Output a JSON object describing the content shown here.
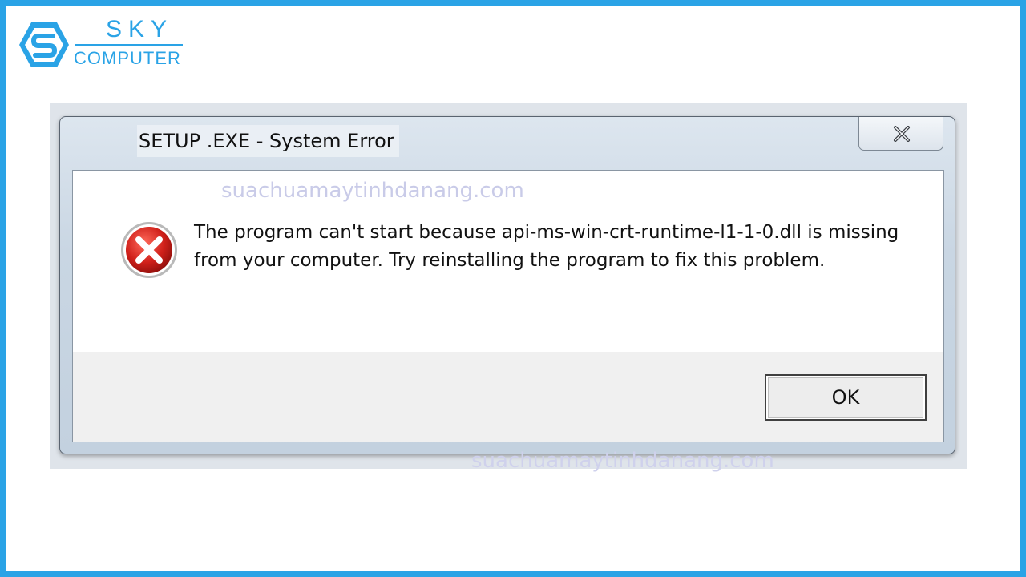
{
  "branding": {
    "logo_top": "SKY",
    "logo_bottom": "COMPUTER",
    "accent_color": "#2aa3e6"
  },
  "watermark": "suachuamaytinhdanang.com",
  "dialog": {
    "title": "SETUP .EXE - System Error",
    "close_icon": "close-icon",
    "status_icon": "error-icon",
    "message": "The program can't start because api-ms-win-crt-runtime-l1-1-0.dll is missing from your computer. Try reinstalling the program to fix this problem.",
    "ok_label": "OK"
  }
}
